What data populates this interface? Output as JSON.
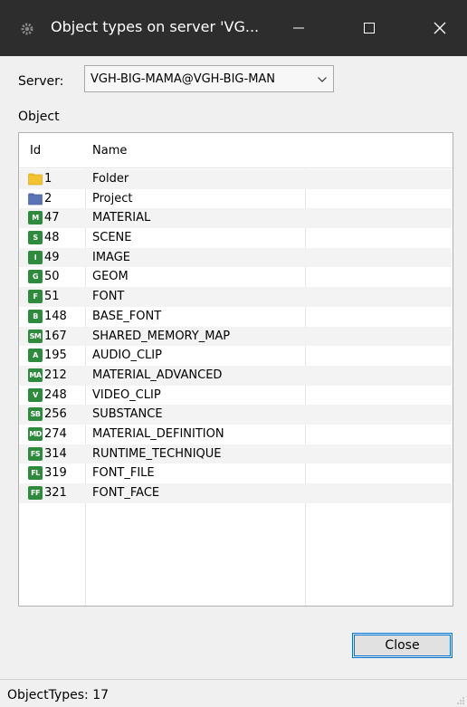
{
  "window": {
    "title": "Object types on server 'VG..."
  },
  "server": {
    "label": "Server:",
    "selected": "VGH-BIG-MAMA@VGH-BIG-MAN"
  },
  "object_section": {
    "label": "Object"
  },
  "table": {
    "columns": [
      "Id",
      "Name"
    ],
    "rows": [
      {
        "icon": "folder-icon",
        "badge": "",
        "id": "1",
        "name": "Folder"
      },
      {
        "icon": "project-icon",
        "badge": "",
        "id": "2",
        "name": "Project"
      },
      {
        "icon": "material-icon",
        "badge": "M",
        "id": "47",
        "name": "MATERIAL"
      },
      {
        "icon": "scene-icon",
        "badge": "S",
        "id": "48",
        "name": "SCENE"
      },
      {
        "icon": "image-icon",
        "badge": "I",
        "id": "49",
        "name": "IMAGE"
      },
      {
        "icon": "geom-icon",
        "badge": "G",
        "id": "50",
        "name": "GEOM"
      },
      {
        "icon": "font-icon",
        "badge": "F",
        "id": "51",
        "name": "FONT"
      },
      {
        "icon": "base-font-icon",
        "badge": "B",
        "id": "148",
        "name": "BASE_FONT"
      },
      {
        "icon": "shared-memory-icon",
        "badge": "SM",
        "id": "167",
        "name": "SHARED_MEMORY_MAP"
      },
      {
        "icon": "audio-clip-icon",
        "badge": "A",
        "id": "195",
        "name": "AUDIO_CLIP"
      },
      {
        "icon": "material-advanced-icon",
        "badge": "MA",
        "id": "212",
        "name": "MATERIAL_ADVANCED"
      },
      {
        "icon": "video-clip-icon",
        "badge": "V",
        "id": "248",
        "name": "VIDEO_CLIP"
      },
      {
        "icon": "substance-icon",
        "badge": "SB",
        "id": "256",
        "name": "SUBSTANCE"
      },
      {
        "icon": "material-definition-icon",
        "badge": "MD",
        "id": "274",
        "name": "MATERIAL_DEFINITION"
      },
      {
        "icon": "runtime-technique-icon",
        "badge": "FS",
        "id": "314",
        "name": "RUNTIME_TECHNIQUE"
      },
      {
        "icon": "font-file-icon",
        "badge": "FL",
        "id": "319",
        "name": "FONT_FILE"
      },
      {
        "icon": "font-face-icon",
        "badge": "FF",
        "id": "321",
        "name": "FONT_FACE"
      }
    ]
  },
  "buttons": {
    "close": "Close"
  },
  "status": {
    "text": "ObjectTypes: 17"
  },
  "colors": {
    "titlebar": "#2d2d2d",
    "badge_green": "#2e8b3d",
    "folder_yellow": "#f2c230",
    "project_blue": "#5b74b5",
    "focus_blue": "#0078d7"
  }
}
